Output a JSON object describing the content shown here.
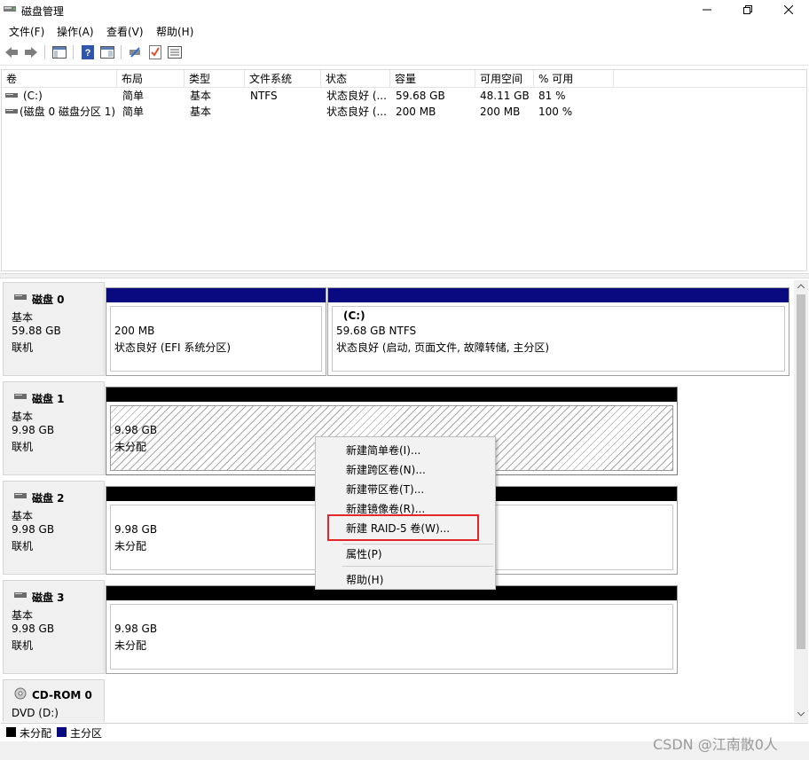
{
  "window": {
    "title": "磁盘管理"
  },
  "menu": [
    "文件(F)",
    "操作(A)",
    "查看(V)",
    "帮助(H)"
  ],
  "volume_list": {
    "columns": [
      "卷",
      "布局",
      "类型",
      "文件系统",
      "状态",
      "容量",
      "可用空间",
      "% 可用"
    ],
    "rows": [
      [
        "(C:)",
        "简单",
        "基本",
        "NTFS",
        "状态良好 (...",
        "59.68 GB",
        "48.11 GB",
        "81 %"
      ],
      [
        "(磁盘 0 磁盘分区 1)",
        "简单",
        "基本",
        "",
        "状态良好 (...",
        "200 MB",
        "200 MB",
        "100 %"
      ]
    ]
  },
  "disks": [
    {
      "name": "磁盘 0",
      "type": "基本",
      "size": "59.88 GB",
      "state": "联机",
      "partitions": [
        {
          "title": "",
          "size": "200 MB",
          "status": "状态良好 (EFI 系统分区)"
        },
        {
          "title": "(C:)",
          "size": "59.68 GB NTFS",
          "status": "状态良好 (启动, 页面文件, 故障转储, 主分区)"
        }
      ]
    },
    {
      "name": "磁盘 1",
      "type": "基本",
      "size": "9.98 GB",
      "state": "联机",
      "partitions": [
        {
          "size": "9.98 GB",
          "status": "未分配"
        }
      ]
    },
    {
      "name": "磁盘 2",
      "type": "基本",
      "size": "9.98 GB",
      "state": "联机",
      "partitions": [
        {
          "size": "9.98 GB",
          "status": "未分配"
        }
      ]
    },
    {
      "name": "磁盘 3",
      "type": "基本",
      "size": "9.98 GB",
      "state": "联机",
      "partitions": [
        {
          "size": "9.98 GB",
          "status": "未分配"
        }
      ]
    },
    {
      "name": "CD-ROM 0",
      "type": "DVD (D:)"
    }
  ],
  "legend": {
    "unallocated": "未分配",
    "primary": "主分区"
  },
  "context_menu": {
    "items": [
      "新建简单卷(I)...",
      "新建跨区卷(N)...",
      "新建带区卷(T)...",
      "新建镜像卷(R)...",
      "新建 RAID-5 卷(W)...",
      "属性(P)",
      "帮助(H)"
    ]
  },
  "watermark": "CSDN @江南散0人",
  "colors": {
    "primary_partition": "#0a0a80",
    "unallocated": "#000000",
    "highlight_box": "#e2262a"
  },
  "icons": [
    "app-disk-icon",
    "minimize-icon",
    "restore-icon",
    "close-icon",
    "back-arrow-icon",
    "forward-arrow-icon",
    "disk-icon",
    "cdrom-icon"
  ]
}
